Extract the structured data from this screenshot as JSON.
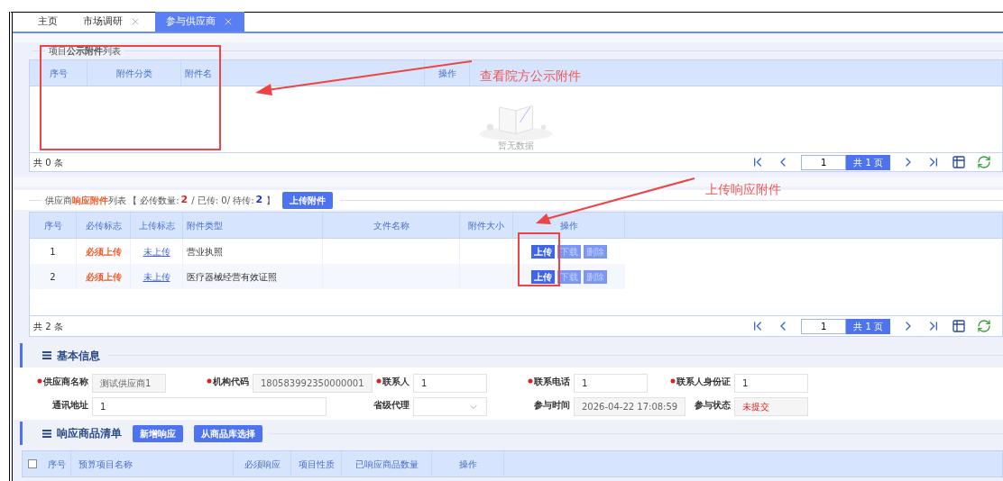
{
  "tabs": [
    {
      "label": "主页",
      "closable": false,
      "selected": false
    },
    {
      "label": "市场调研",
      "closable": true,
      "selected": false
    },
    {
      "label": "参与供应商",
      "closable": true,
      "selected": true
    }
  ],
  "public_attachments": {
    "legend": "项目**公示附件**列表",
    "columns": [
      "序号",
      "附件分类",
      "附件名",
      "操作"
    ],
    "empty_text": "暂无数据",
    "total": "共 0 条",
    "pager": {
      "page": "1",
      "pages": "共 1 页"
    }
  },
  "response_attachments": {
    "legend": "供应商**响应附件**列表",
    "summary": [
      {
        "kind": "text",
        "text": "【 必传数量:"
      },
      {
        "kind": "required",
        "text": "2"
      },
      {
        "kind": "text",
        "text": "/ 已传: 0/ 待传:"
      },
      {
        "kind": "pending",
        "text": "2"
      },
      {
        "kind": "text",
        "text": "】"
      }
    ],
    "upload_button": "上传附件",
    "columns": [
      "序号",
      "必传标志",
      "上传标志",
      "附件类型",
      "文件名称",
      "附件大小",
      "操作"
    ],
    "rows": [
      {
        "index": "1",
        "required": "必须上传",
        "upload_status": "未上传",
        "type": "营业执照",
        "actions": [
          {
            "label": "上传",
            "disabled": false
          },
          {
            "label": "下载",
            "disabled": true
          },
          {
            "label": "删除",
            "disabled": true
          }
        ]
      },
      {
        "index": "2",
        "required": "必须上传",
        "upload_status": "未上传",
        "type": "医疗器械经营有效证照",
        "actions": [
          {
            "label": "上传",
            "disabled": false
          },
          {
            "label": "下载",
            "disabled": true
          },
          {
            "label": "删除",
            "disabled": true
          }
        ]
      }
    ],
    "total": "共 2 条",
    "pager": {
      "page": "1",
      "pages": "共 1 页"
    }
  },
  "basic_info": {
    "title": "基本信息",
    "rows": [
      [
        {
          "label": "供应商名称",
          "required": true,
          "kind": "readonly",
          "value": "测试供应商1"
        },
        {
          "label": "机构代码",
          "required": true,
          "kind": "readonly",
          "value": "180583992350000001"
        },
        {
          "label": "联系人",
          "required": true,
          "kind": "text",
          "value": "1"
        },
        {
          "label": "联系电话",
          "required": true,
          "kind": "text",
          "value": "1"
        },
        {
          "label": "联系人身份证",
          "required": true,
          "kind": "text",
          "value": "1"
        }
      ],
      [
        {
          "label": "通讯地址",
          "required": false,
          "kind": "text",
          "value": "1",
          "colspan": 2
        },
        {
          "label": "省级代理",
          "required": false,
          "kind": "select"
        },
        {
          "label": "参与时间",
          "required": false,
          "kind": "readonly",
          "value": "2026-04-22 17:08:59"
        },
        {
          "label": "参与状态",
          "required": false,
          "kind": "status",
          "value": "未提交"
        }
      ]
    ]
  },
  "product_list": {
    "title": "响应商品清单",
    "buttons": [
      "新增响应",
      "从商品库选择"
    ],
    "select_all_checked": false,
    "columns": [
      "序号",
      "预算项目名称",
      "必须响应",
      "项目性质",
      "已响应商品数量",
      "操作"
    ]
  },
  "annotations": [
    {
      "text": "查看院方公示附件"
    },
    {
      "text": "上传响应附件"
    }
  ]
}
